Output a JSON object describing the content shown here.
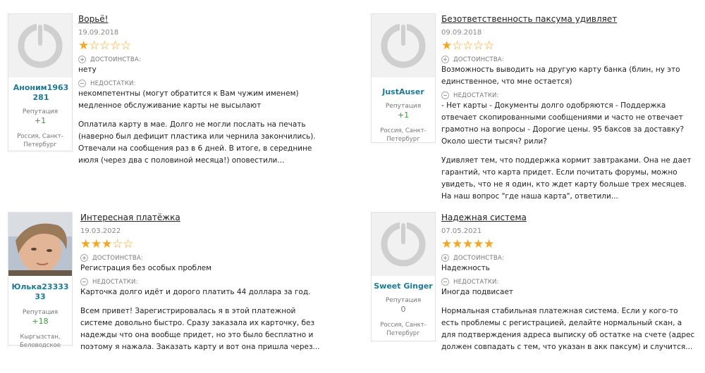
{
  "labels": {
    "pros": "ДОСТОИНСТВА:",
    "cons": "НЕДОСТАТКИ:",
    "reputation": "Репутация"
  },
  "colors": {
    "star": "#f5a623",
    "username": "#1a7a98",
    "reputation_positive": "#3c9a3c"
  },
  "reviews": [
    {
      "author": "Аноним1963281",
      "reputation": "+1",
      "location": "Россия, Санкт-Петербург",
      "avatar": "default-avatar-icon",
      "title": "Ворьё!",
      "date": "19.09.2018",
      "rating": 1,
      "pros": "нету",
      "cons": "некомпетентны (могут обратится к Вам чужим именем) медленное обслуживание карты не высылают",
      "text": "Оплатила карту в мае. Долго не могли послать на печать (наверно был дефицит пластика или чернила закончились). Отвечали на сообщения раз в 6 дней. В итоге, в середнине июля (через два с половиной месяца!) оповестили..."
    },
    {
      "author": "JustAuser",
      "reputation": "+1",
      "location": "Россия, Санкт-Петербург",
      "avatar": "default-avatar-icon",
      "title": "Безответственность паксума удивляет",
      "date": "09.09.2018",
      "rating": 1,
      "pros": "Возможность выводить на другую карту банка (блин, ну это единственное, что мне остается)",
      "cons": "- Нет карты - Документы долго одобряются - Поддержка отвечает скопированными сообщениями и часто не отвечает грамотно на вопросы - Дорогие цены. 95 баксов за доставку? Около шести тысяч? рили?",
      "text": "Удивляет тем, что поддержка кормит завтраками. Она не дает гарантий, что карта придет. Если почитать форумы, можно увидеть, что не я один, кто ждет карту больше трех месяцев. На наш вопрос \"где наша карта\", ответили..."
    },
    {
      "author": "Юлька2333333",
      "reputation": "+18",
      "location": "Кыргызстан, Беловодское",
      "avatar": "user-photo",
      "title": "Интересная платёжка",
      "date": "19.03.2022",
      "rating": 3,
      "pros": "Регистрация без особых проблем",
      "cons": "Карточка долго идёт и дорого платить 44 доллара за год.",
      "text": "Всем привет! Зарегистрировалась я в этой платежной системе довольно быстро. Сразу заказала их карточку, без надежды что она вообще придет, но это было бесплатно и поэтому я нажала. Заказать карту и вот она пришла через..."
    },
    {
      "author": "Sweet Ginger",
      "reputation": "0",
      "location": "Россия, Санкт-Петербург",
      "avatar": "default-avatar-icon",
      "title": "Надежная система",
      "date": "07.05.2021",
      "rating": 5,
      "pros": "Надежность",
      "cons": "Иногда подвисает",
      "text": "Нормальная стабильная платежная система. Если у кого-то есть проблемы с регистрацией, делайте нормальный скан, а для подтверждения адреса выписку об остатке на счете (адрес должен совпадать с тем, что указан в акк паксум) и случится..."
    }
  ]
}
